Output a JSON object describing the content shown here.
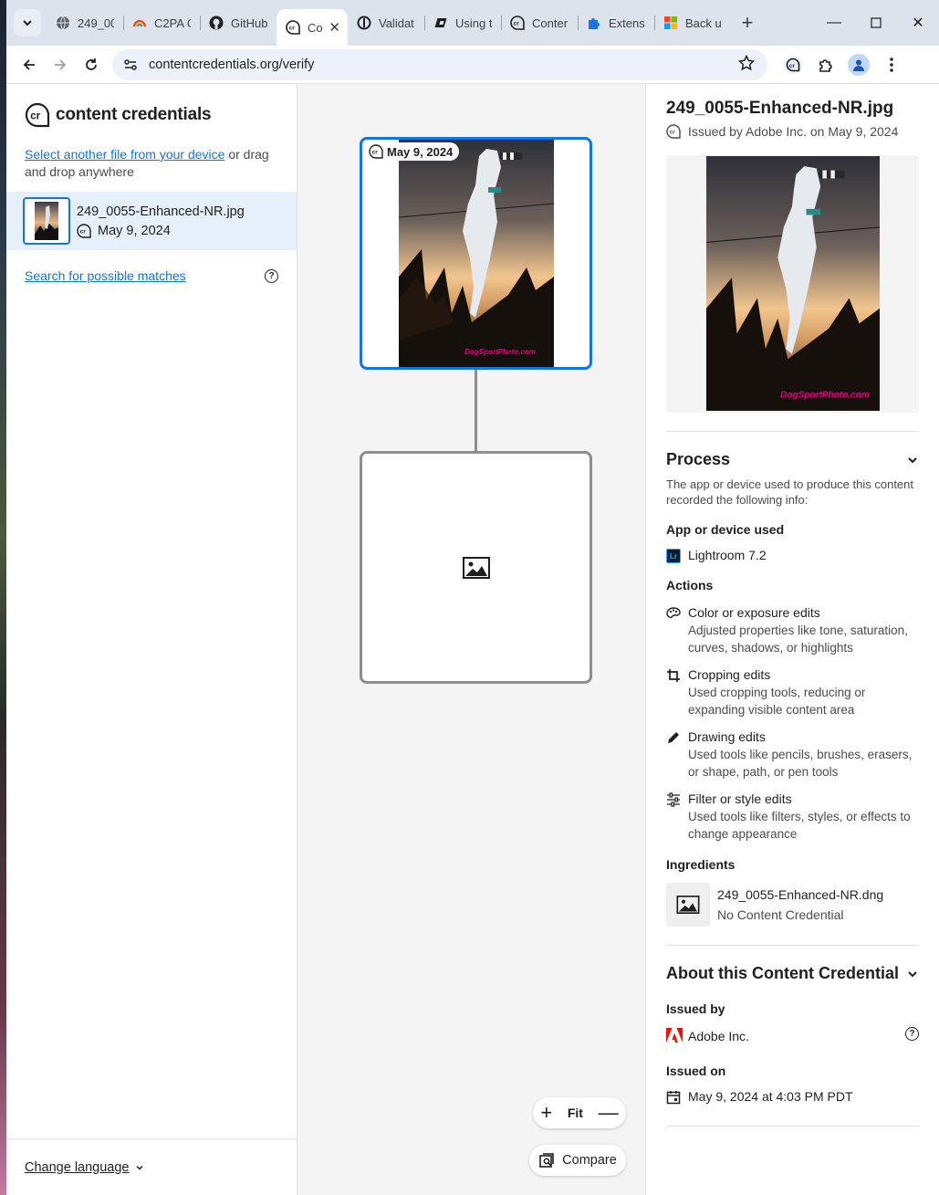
{
  "browser": {
    "tabs": [
      {
        "label": "249_00",
        "icon": "globe-icon"
      },
      {
        "label": "C2PA C",
        "icon": "rainbow-icon"
      },
      {
        "label": "GitHub",
        "icon": "github-icon"
      },
      {
        "label": "Co",
        "icon": "content-credentials-icon",
        "active": true
      },
      {
        "label": "Validat",
        "icon": "validate-icon"
      },
      {
        "label": "Using t",
        "icon": "sync-icon"
      },
      {
        "label": "Conter",
        "icon": "content-credentials-icon"
      },
      {
        "label": "Extensi",
        "icon": "puzzle-icon"
      },
      {
        "label": "Back u",
        "icon": "microsoft-icon"
      }
    ],
    "url": "contentcredentials.org/verify"
  },
  "sidebar": {
    "brand": "content credentials",
    "select_link": "Select another file from your device",
    "select_rest": " or drag and drop anywhere",
    "file": {
      "name": "249_0055-Enhanced-NR.jpg",
      "date": "May 9, 2024"
    },
    "search_link": "Search for possible matches",
    "language": "Change language"
  },
  "graph": {
    "main_date": "May 9, 2024",
    "fit_label": "Fit",
    "compare_label": "Compare",
    "watermark": "DogSportPhoto.com"
  },
  "details": {
    "title": "249_0055-Enhanced-NR.jpg",
    "issued_line": "Issued by Adobe Inc. on May 9, 2024",
    "process": {
      "heading": "Process",
      "description": "The app or device used to produce this content recorded the following info:",
      "app_heading": "App or device used",
      "app": "Lightroom 7.2",
      "app_badge": "Lr",
      "actions_heading": "Actions",
      "actions": [
        {
          "title": "Color or exposure edits",
          "desc": "Adjusted properties like tone, saturation, curves, shadows, or highlights",
          "icon": "palette-icon"
        },
        {
          "title": "Cropping edits",
          "desc": "Used cropping tools, reducing or expanding visible content area",
          "icon": "crop-icon"
        },
        {
          "title": "Drawing edits",
          "desc": "Used tools like pencils, brushes, erasers, or shape, path, or pen tools",
          "icon": "pencil-icon"
        },
        {
          "title": "Filter or style edits",
          "desc": "Used tools like filters, styles, or effects to change appearance",
          "icon": "sliders-icon"
        }
      ],
      "ingredients_heading": "Ingredients",
      "ingredient": {
        "name": "249_0055-Enhanced-NR.dng",
        "status": "No Content Credential"
      }
    },
    "about": {
      "heading": "About this Content Credential",
      "issued_by_heading": "Issued by",
      "issuer": "Adobe Inc.",
      "issued_on_heading": "Issued on",
      "issued_on": "May 9, 2024 at 4:03 PM PDT"
    }
  },
  "colors": {
    "accent": "#1473e6",
    "selected_bg": "#e5f0fc",
    "canvas_bg": "#f4f4f4",
    "adobe_red": "#eb1000"
  }
}
